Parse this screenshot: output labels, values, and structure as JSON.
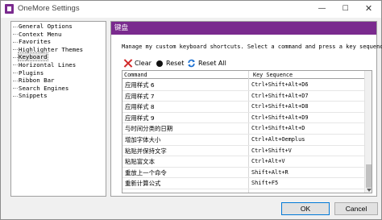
{
  "window": {
    "title": "OneMore Settings",
    "controls": {
      "minimize": "—",
      "maximize": "☐",
      "close": "✕"
    }
  },
  "nav": {
    "items": [
      {
        "label": "General Options"
      },
      {
        "label": "Context Menu"
      },
      {
        "label": "Favorites"
      },
      {
        "label": "Highlighter Themes"
      },
      {
        "label": "Keyboard",
        "selected": true
      },
      {
        "label": "Horizontal Lines"
      },
      {
        "label": "Plugins"
      },
      {
        "label": "Ribbon Bar"
      },
      {
        "label": "Search Engines"
      },
      {
        "label": "Snippets"
      }
    ]
  },
  "panel": {
    "header": "键盘",
    "instructions": "Manage my custom keyboard shortcuts. Select a command and press a key sequence."
  },
  "toolbar": {
    "clear_label": "Clear",
    "reset_label": "Reset",
    "reset_all_label": "Reset All"
  },
  "grid": {
    "columns": {
      "command": "Command",
      "key": "Key Sequence"
    },
    "rows": [
      {
        "command": "应用样式 6",
        "key": "Ctrl+Shift+Alt+D6"
      },
      {
        "command": "应用样式 7",
        "key": "Ctrl+Shift+Alt+D7"
      },
      {
        "command": "应用样式 8",
        "key": "Ctrl+Shift+Alt+D8"
      },
      {
        "command": "应用样式 9",
        "key": "Ctrl+Shift+Alt+D9"
      },
      {
        "command": "与时间分类的日期",
        "key": "Ctrl+Shift+Alt+D"
      },
      {
        "command": "增加字体大小",
        "key": "Ctrl+Alt+Oemplus"
      },
      {
        "command": "粘贴并保持文字",
        "key": "Ctrl+Shift+V"
      },
      {
        "command": "粘贴富文本",
        "key": "Ctrl+Alt+V"
      },
      {
        "command": "重放上一个命令",
        "key": "Shift+Alt+R"
      },
      {
        "command": "重新计算公式",
        "key": "Shift+F5"
      }
    ]
  },
  "buttons": {
    "ok_label": "OK",
    "cancel_label": "Cancel"
  },
  "colors": {
    "accent": "#7a2a8e",
    "clear_icon": "#d22a2a",
    "reset_all_icon": "#1a6fd1"
  }
}
